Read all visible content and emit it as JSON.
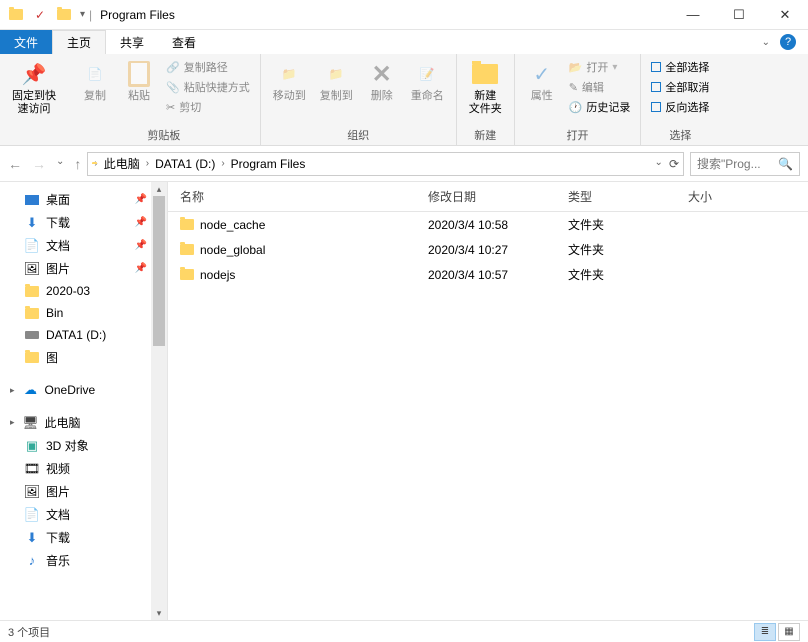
{
  "window": {
    "title": "Program Files"
  },
  "tabs": {
    "file": "文件",
    "home": "主页",
    "share": "共享",
    "view": "查看"
  },
  "ribbon": {
    "pin": "固定到快\n速访问",
    "copy": "复制",
    "paste": "粘贴",
    "copypath": "复制路径",
    "pasteshortcut": "粘贴快捷方式",
    "cut": "剪切",
    "clipboard_group": "剪贴板",
    "moveto": "移动到",
    "copyto": "复制到",
    "delete": "删除",
    "rename": "重命名",
    "organize_group": "组织",
    "newfolder": "新建\n文件夹",
    "new_group": "新建",
    "properties": "属性",
    "open": "打开",
    "edit": "编辑",
    "history": "历史记录",
    "open_group": "打开",
    "selectall": "全部选择",
    "selectnone": "全部取消",
    "invert": "反向选择",
    "select_group": "选择"
  },
  "breadcrumb": {
    "pc": "此电脑",
    "drive": "DATA1 (D:)",
    "folder": "Program Files"
  },
  "search": {
    "placeholder": "搜索\"Prog..."
  },
  "sidebar": {
    "items": [
      {
        "label": "桌面",
        "icon": "desktop",
        "pinned": true
      },
      {
        "label": "下载",
        "icon": "download",
        "pinned": true
      },
      {
        "label": "文档",
        "icon": "document",
        "pinned": true
      },
      {
        "label": "图片",
        "icon": "pictures",
        "pinned": true
      },
      {
        "label": "2020-03",
        "icon": "folder",
        "pinned": false
      },
      {
        "label": "Bin",
        "icon": "folder",
        "pinned": false
      },
      {
        "label": "DATA1 (D:)",
        "icon": "drive",
        "pinned": false
      },
      {
        "label": "图",
        "icon": "folder",
        "pinned": false
      }
    ],
    "onedrive": "OneDrive",
    "thispc": "此电脑",
    "pcitems": [
      {
        "label": "3D 对象",
        "icon": "3d"
      },
      {
        "label": "视频",
        "icon": "video"
      },
      {
        "label": "图片",
        "icon": "pictures"
      },
      {
        "label": "文档",
        "icon": "document"
      },
      {
        "label": "下载",
        "icon": "download"
      },
      {
        "label": "音乐",
        "icon": "music"
      }
    ]
  },
  "columns": {
    "name": "名称",
    "date": "修改日期",
    "type": "类型",
    "size": "大小"
  },
  "files": [
    {
      "name": "node_cache",
      "date": "2020/3/4 10:58",
      "type": "文件夹"
    },
    {
      "name": "node_global",
      "date": "2020/3/4 10:27",
      "type": "文件夹"
    },
    {
      "name": "nodejs",
      "date": "2020/3/4 10:57",
      "type": "文件夹"
    }
  ],
  "status": {
    "count": "3 个项目"
  }
}
